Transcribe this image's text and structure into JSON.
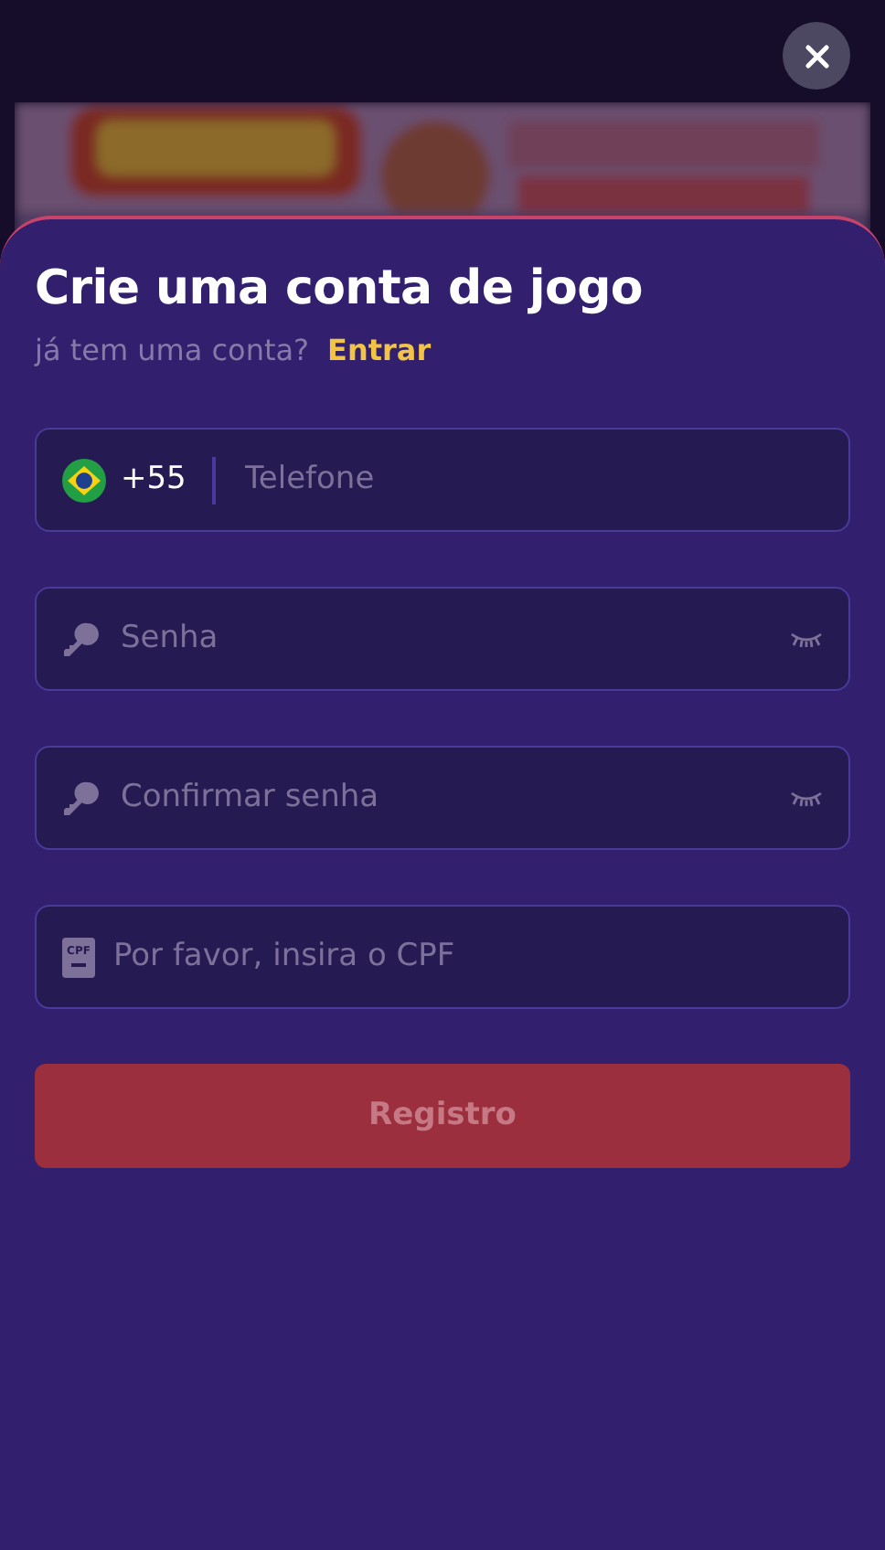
{
  "title": "Crie uma conta de jogo",
  "subtitle": {
    "text": "já tem uma conta?",
    "link": "Entrar"
  },
  "fields": [
    {
      "kind": "phone",
      "country_code": "+55",
      "placeholder": "Telefone"
    },
    {
      "kind": "password",
      "placeholder": "Senha"
    },
    {
      "kind": "password",
      "placeholder": "Confirmar senha"
    },
    {
      "kind": "cpf",
      "badge": "CPF",
      "placeholder": "Por favor, insira o CPF"
    }
  ],
  "submit": {
    "label": "Registro",
    "disabled": true
  }
}
